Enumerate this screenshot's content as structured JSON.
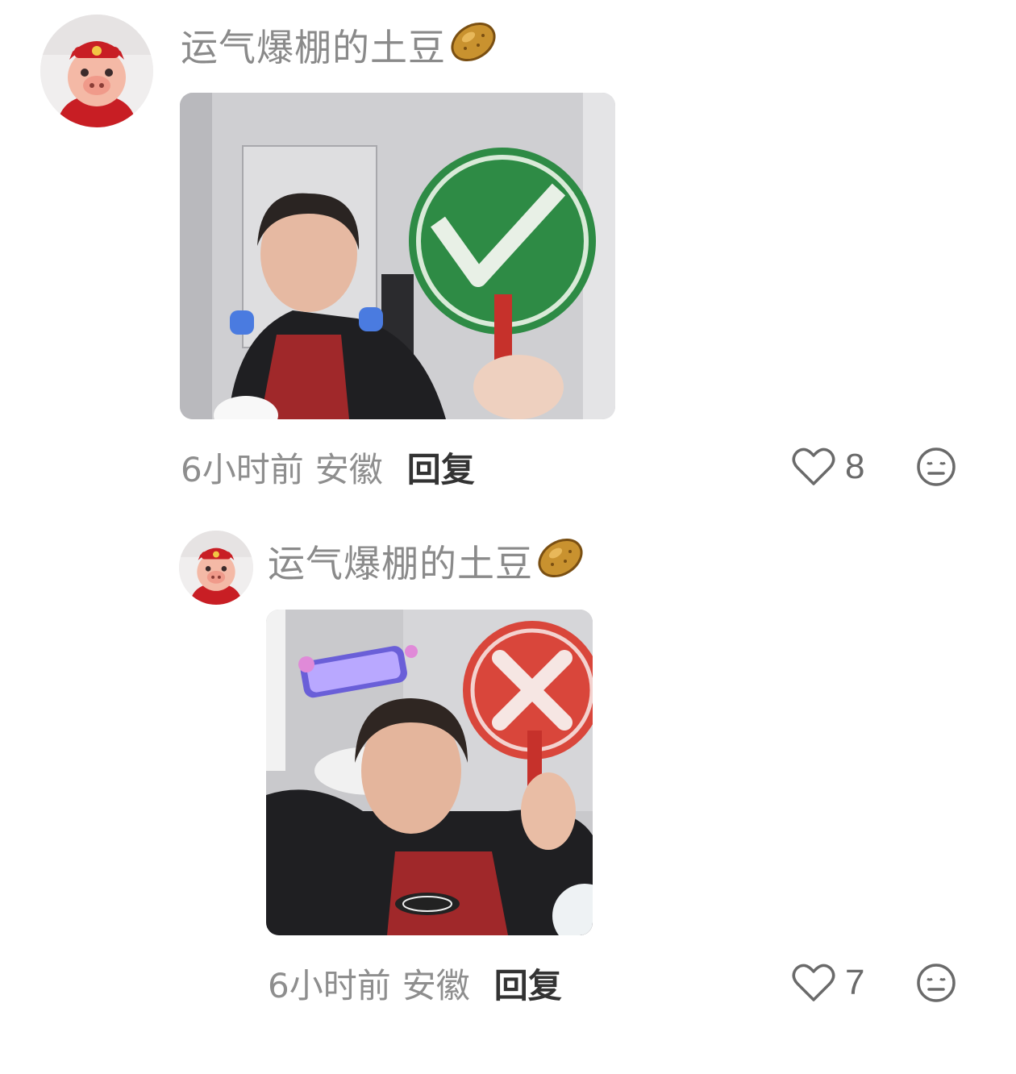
{
  "comments": [
    {
      "username": "运气爆棚的土豆",
      "time": "6小时前",
      "location": "安徽",
      "reply_label": "回复",
      "like_count": "8",
      "sticker": "check-sign-meme"
    },
    {
      "username": "运气爆棚的土豆",
      "time": "6小时前",
      "location": "安徽",
      "reply_label": "回复",
      "like_count": "7",
      "sticker": "cross-sign-meme"
    }
  ],
  "icons": {
    "like": "heart-outline-icon",
    "reaction": "neutral-face-icon",
    "username_emoji": "potato-emoji"
  },
  "colors": {
    "username": "#8a8a8a",
    "meta": "#8e8e8e",
    "reply": "#333333",
    "check_sign": "#2e8b45",
    "cross_sign": "#d9463b"
  }
}
